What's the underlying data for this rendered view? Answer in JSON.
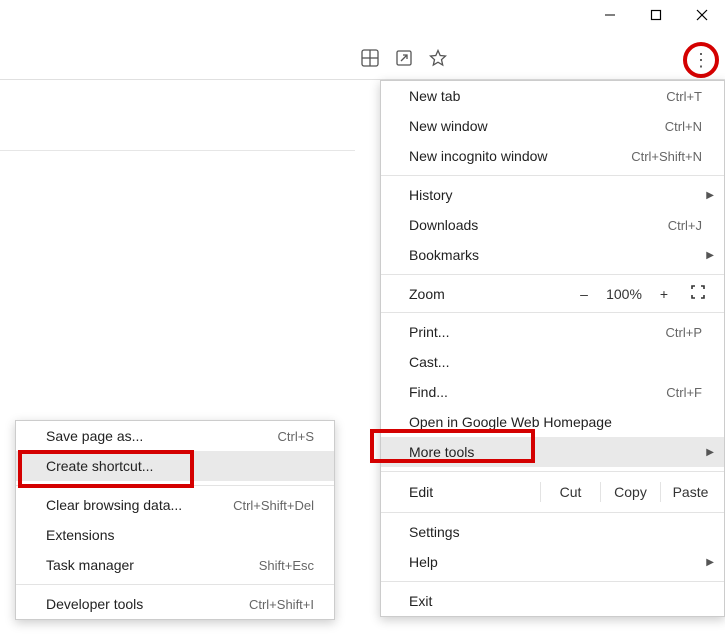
{
  "windowControls": {
    "min": "minimize",
    "max": "maximize",
    "close": "close"
  },
  "menu": {
    "newTab": {
      "label": "New tab",
      "shortcut": "Ctrl+T"
    },
    "newWindow": {
      "label": "New window",
      "shortcut": "Ctrl+N"
    },
    "newIncognito": {
      "label": "New incognito window",
      "shortcut": "Ctrl+Shift+N"
    },
    "history": {
      "label": "History"
    },
    "downloads": {
      "label": "Downloads",
      "shortcut": "Ctrl+J"
    },
    "bookmarks": {
      "label": "Bookmarks"
    },
    "zoom": {
      "label": "Zoom",
      "minus": "–",
      "value": "100%",
      "plus": "+"
    },
    "print": {
      "label": "Print...",
      "shortcut": "Ctrl+P"
    },
    "cast": {
      "label": "Cast..."
    },
    "find": {
      "label": "Find...",
      "shortcut": "Ctrl+F"
    },
    "openHomepage": {
      "label": "Open in Google Web Homepage"
    },
    "moreTools": {
      "label": "More tools"
    },
    "edit": {
      "label": "Edit",
      "cut": "Cut",
      "copy": "Copy",
      "paste": "Paste"
    },
    "settings": {
      "label": "Settings"
    },
    "help": {
      "label": "Help"
    },
    "exit": {
      "label": "Exit"
    }
  },
  "submenu": {
    "savePage": {
      "label": "Save page as...",
      "shortcut": "Ctrl+S"
    },
    "createShortcut": {
      "label": "Create shortcut..."
    },
    "clearBrowsing": {
      "label": "Clear browsing data...",
      "shortcut": "Ctrl+Shift+Del"
    },
    "extensions": {
      "label": "Extensions"
    },
    "taskManager": {
      "label": "Task manager",
      "shortcut": "Shift+Esc"
    },
    "devTools": {
      "label": "Developer tools",
      "shortcut": "Ctrl+Shift+I"
    }
  }
}
